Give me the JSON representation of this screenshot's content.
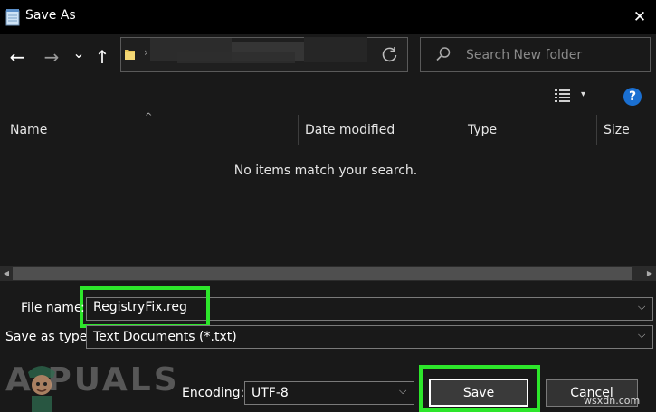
{
  "window": {
    "title": "Save As",
    "close_glyph": "✕"
  },
  "nav": {
    "back_glyph": "←",
    "forward_glyph": "→",
    "recent_glyph": "⌄",
    "up_glyph": "↑",
    "addr_chevron": "›",
    "search_placeholder": "Search New folder"
  },
  "toolbar": {
    "help_label": "?",
    "view_caret": "▾"
  },
  "columns": [
    {
      "label": "Name"
    },
    {
      "label": "Date modified"
    },
    {
      "label": "Type"
    },
    {
      "label": "Size"
    }
  ],
  "sort_indicator": "^",
  "empty_message": "No items match your search.",
  "scroll": {
    "left_glyph": "◀",
    "right_glyph": "▶"
  },
  "form": {
    "file_name_label_a": "File name",
    "file_name_label_b": ":",
    "file_name_value": "RegistryFix.reg",
    "save_type_label": "Save as type:",
    "save_type_value": "Text Documents (*.txt)",
    "encoding_label": "Encoding:",
    "encoding_value": "UTF-8",
    "chevron": "⌵"
  },
  "buttons": {
    "save": "Save",
    "cancel": "Cancel"
  },
  "branding": {
    "logo_text": "A PUALS",
    "watermark": "wsxdn.com"
  },
  "colors": {
    "highlight": "#2de62b",
    "help_blue": "#1a6fd1",
    "background": "#191919"
  },
  "icons": [
    "notepad-icon",
    "close-icon",
    "back-arrow-icon",
    "forward-arrow-icon",
    "recent-locations-chevron-icon",
    "up-arrow-icon",
    "folder-icon",
    "refresh-icon",
    "search-icon",
    "view-options-icon",
    "help-icon"
  ]
}
